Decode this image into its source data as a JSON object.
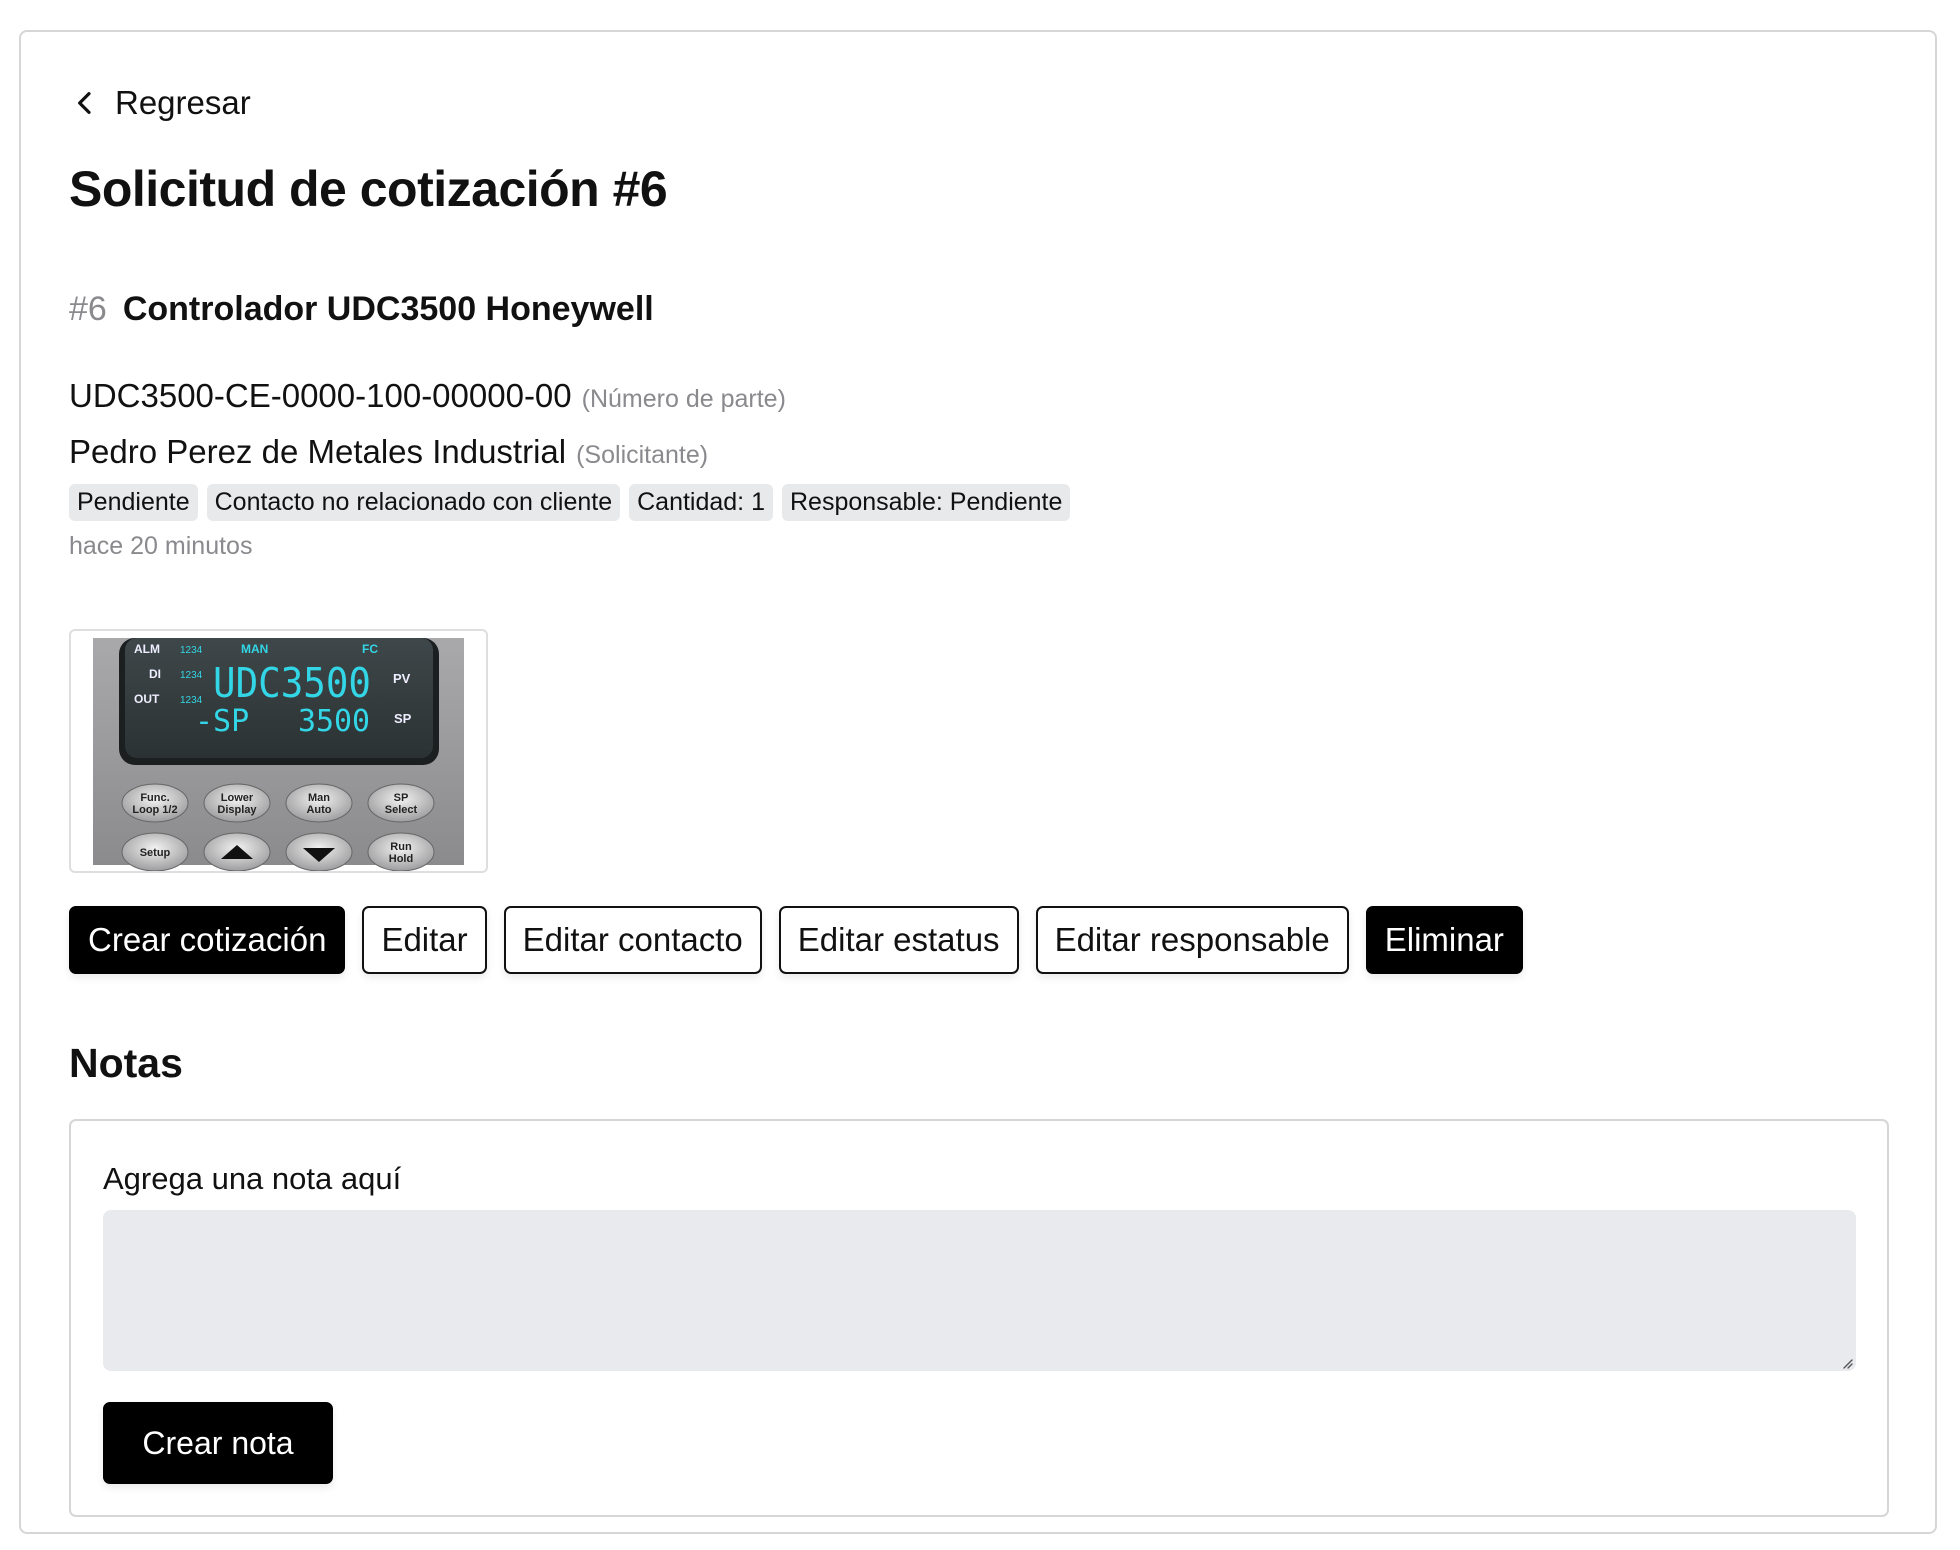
{
  "back": {
    "label": "Regresar"
  },
  "title": "Solicitud de cotización #6",
  "item": {
    "id": "#6",
    "name": "Controlador UDC3500 Honeywell",
    "part_number": "UDC3500-CE-0000-100-00000-00",
    "part_number_note": "(Número de parte)",
    "requester": "Pedro Perez de Metales Industrial",
    "requester_note": "(Solicitante)",
    "badges": [
      "Pendiente",
      "Contacto no relacionado con cliente",
      "Cantidad: 1",
      "Responsable: Pendiente"
    ],
    "time": "hace 20 minutos"
  },
  "image": {
    "display_labels": {
      "alm": "ALM",
      "di": "DI",
      "out": "OUT",
      "digits": "1234",
      "man": "MAN",
      "fc": "FC",
      "pv": "PV",
      "sp": "SP",
      "pv_value": "UDC3500",
      "sp_label": "-SP",
      "sp_value": "3500"
    },
    "keys": {
      "func_1": "Func.",
      "func_2": "Loop 1/2",
      "lower_1": "Lower",
      "lower_2": "Display",
      "man_1": "Man",
      "man_2": "Auto",
      "sp_1": "SP",
      "sp_2": "Select",
      "setup": "Setup",
      "run_1": "Run",
      "run_2": "Hold"
    }
  },
  "actions": {
    "create_quote": "Crear cotización",
    "edit": "Editar",
    "edit_contact": "Editar contacto",
    "edit_status": "Editar estatus",
    "edit_owner": "Editar responsable",
    "delete": "Eliminar"
  },
  "notes": {
    "title": "Notas",
    "label": "Agrega una nota aquí",
    "value": "",
    "submit": "Crear nota"
  },
  "colors": {
    "primary": "#000000",
    "badge_bg": "#e8e9eb",
    "muted_text": "#8a8a8e",
    "input_bg": "#e9eaed",
    "display_text": "#33d6e6"
  },
  "icons": {
    "back": "chevron-left-icon",
    "resize": "resize-grip-icon"
  }
}
